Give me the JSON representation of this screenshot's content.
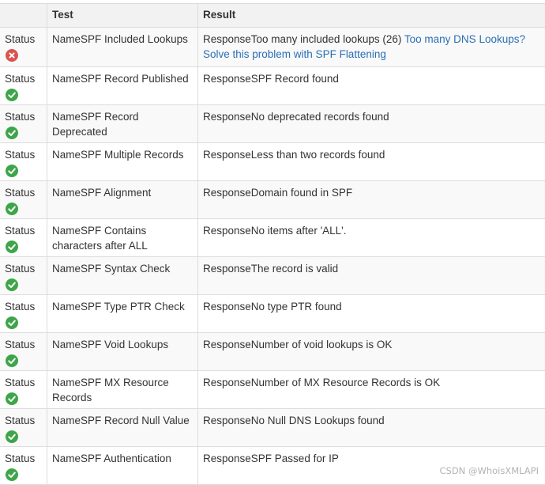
{
  "headers": {
    "col1": "",
    "col2": "Test",
    "col3": "Result"
  },
  "row_label": "Status",
  "colors": {
    "ok": "#3ea54a",
    "fail": "#d9534f",
    "link": "#2a6fb5"
  },
  "rows": [
    {
      "status": "fail",
      "icon": "x-circle-icon",
      "test": "NameSPF Included Lookups",
      "result": "ResponseToo many included lookups (26) ",
      "link": "Too many DNS Lookups? Solve this problem with SPF Flattening"
    },
    {
      "status": "ok",
      "icon": "check-circle-icon",
      "test": "NameSPF Record Published",
      "result": "ResponseSPF Record found"
    },
    {
      "status": "ok",
      "icon": "check-circle-icon",
      "test": "NameSPF Record Deprecated",
      "result": "ResponseNo deprecated records found"
    },
    {
      "status": "ok",
      "icon": "check-circle-icon",
      "test": "NameSPF Multiple Records",
      "result": "ResponseLess than two records found"
    },
    {
      "status": "ok",
      "icon": "check-circle-icon",
      "test": "NameSPF Alignment",
      "result": "ResponseDomain found in SPF"
    },
    {
      "status": "ok",
      "icon": "check-circle-icon",
      "test": "NameSPF Contains characters after ALL",
      "result": "ResponseNo items after 'ALL'."
    },
    {
      "status": "ok",
      "icon": "check-circle-icon",
      "test": "NameSPF Syntax Check",
      "result": "ResponseThe record is valid"
    },
    {
      "status": "ok",
      "icon": "check-circle-icon",
      "test": "NameSPF Type PTR Check",
      "result": "ResponseNo type PTR found"
    },
    {
      "status": "ok",
      "icon": "check-circle-icon",
      "test": "NameSPF Void Lookups",
      "result": "ResponseNumber of void lookups is OK"
    },
    {
      "status": "ok",
      "icon": "check-circle-icon",
      "test": "NameSPF MX Resource Records",
      "result": "ResponseNumber of MX Resource Records is OK"
    },
    {
      "status": "ok",
      "icon": "check-circle-icon",
      "test": "NameSPF Record Null Value",
      "result": "ResponseNo Null DNS Lookups found"
    },
    {
      "status": "ok",
      "icon": "check-circle-icon",
      "test": "NameSPF Authentication",
      "result": "ResponseSPF Passed for IP"
    }
  ],
  "watermark": "CSDN @WhoisXMLAPI"
}
